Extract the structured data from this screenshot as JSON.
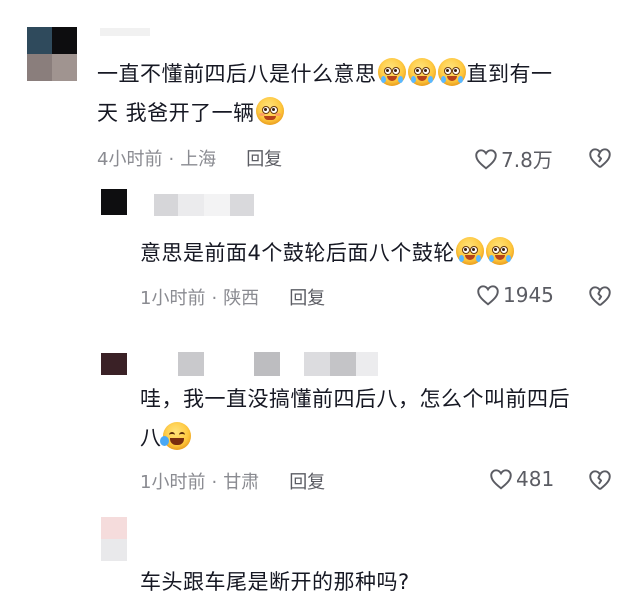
{
  "comments": [
    {
      "text_line1": "一直不懂前四后八是什么意思",
      "text_line1_tail": "直到有一",
      "text_line2": "天 我爸开了一辆",
      "time": "4小时前",
      "location": "上海",
      "reply_label": "回复",
      "likes": "7.8万"
    },
    {
      "text": "意思是前面4个鼓轮后面八个鼓轮",
      "time": "1小时前",
      "location": "陕西",
      "reply_label": "回复",
      "likes": "1945"
    },
    {
      "text_line1": "哇，我一直没搞懂前四后八，怎么个叫前四后",
      "text_line2": "八",
      "time": "1小时前",
      "location": "甘肃",
      "reply_label": "回复",
      "likes": "481"
    },
    {
      "text": "车头跟车尾是断开的那种吗?"
    }
  ],
  "icons": {
    "like": "heart-outline-icon",
    "dislike": "broken-heart-icon"
  },
  "colors": {
    "text": "#161823",
    "meta": "#8a8b91",
    "emoji": "#ffc83d"
  }
}
